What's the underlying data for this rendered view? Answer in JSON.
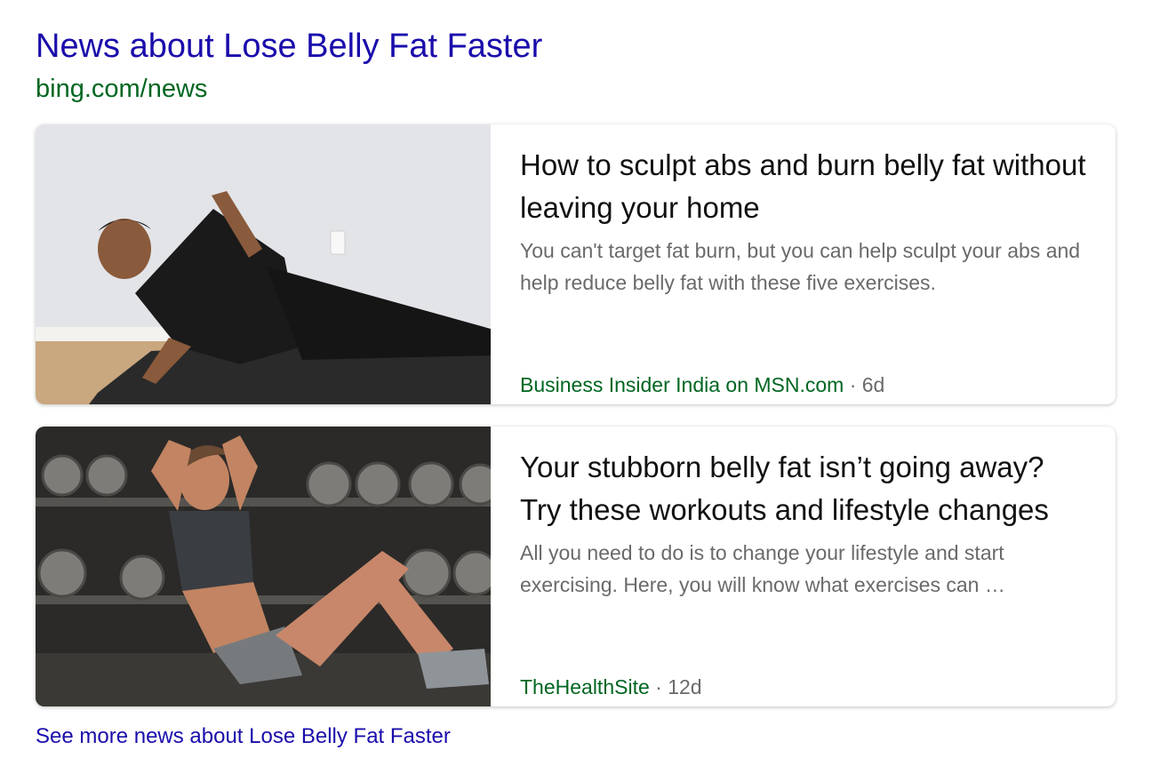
{
  "header": {
    "title": "News about Lose Belly Fat Faster",
    "url": "bing.com/news"
  },
  "articles": [
    {
      "title": "How to sculpt abs and burn belly fat without leaving your home",
      "snippet": "You can't target fat burn, but you can help sculpt your abs and help reduce belly fat with these five exercises.",
      "source": "Business Insider India on MSN.com",
      "age": " · 6d"
    },
    {
      "title": "Your stubborn belly fat isn’t going away? Try these workouts and lifestyle changes",
      "snippet": "All you need to do is to change your lifestyle and start exercising. Here, you will know what exercises can …",
      "source": "TheHealthSite",
      "age": " · 12d"
    }
  ],
  "footer": {
    "see_more": "See more news about Lose Belly Fat Faster"
  },
  "colors": {
    "link": "#1a0dab",
    "url_green": "#006621",
    "snippet_gray": "#6a6a6a"
  }
}
